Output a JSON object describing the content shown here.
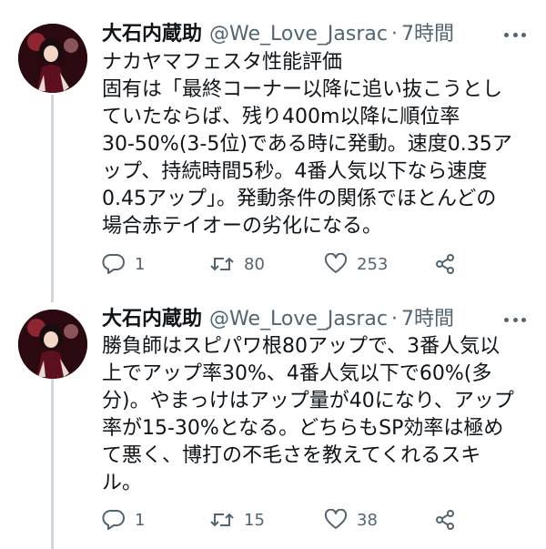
{
  "tweets": [
    {
      "name": "大石内蔵助",
      "handle": "@We_Love_Jasrac",
      "dot": "·",
      "time": "7時間",
      "lines": [
        "ナカヤマフェスタ性能評価",
        "固有は「最終コーナー以降に追い抜こうとし",
        "ていたならば、残り400m以降に順位率",
        "30-50%(3-5位)である時に発動。速度0.35ア",
        "ップ、持続時間5秒。4番人気以下なら速度",
        "0.45アップ」。発動条件の関係でほとんどの",
        "場合赤テイオーの劣化になる。"
      ],
      "reply_count": "1",
      "retweet_count": "80",
      "like_count": "253"
    },
    {
      "name": "大石内蔵助",
      "handle": "@We_Love_Jasrac",
      "dot": "·",
      "time": "7時間",
      "lines": [
        "勝負師はスピパワ根80アップで、3番人気以",
        "上でアップ率30%、4番人気以下で60%(多",
        "分)。やまっけはアップ量が40になり、アップ",
        "率が15-30%となる。どちらもSP効率は極め",
        "て悪く、博打の不毛さを教えてくれるスキ",
        "ル。"
      ],
      "reply_count": "1",
      "retweet_count": "15",
      "like_count": "38"
    }
  ],
  "icons": {
    "avatar": "avatar-image",
    "more": "more-dots-icon",
    "reply": "reply-icon",
    "retweet": "retweet-icon",
    "like": "heart-icon",
    "share": "share-icon"
  },
  "colors": {
    "text": "#0f1419",
    "secondary": "#536471",
    "thread_line": "#cfd9de",
    "background": "#ffffff"
  }
}
